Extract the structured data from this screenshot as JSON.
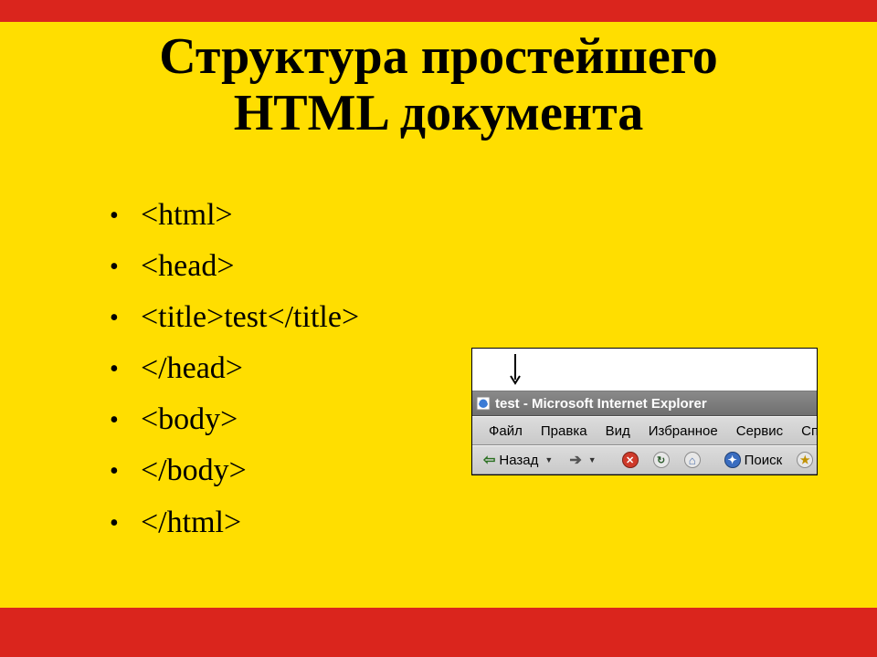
{
  "title_line1": "Структура простейшего",
  "title_line2": "HTML документа",
  "bullets": [
    "<html>",
    "<head>",
    "<title>test</title>",
    "</head>",
    "<body>",
    "</body>",
    "</html>"
  ],
  "browser": {
    "title": "test - Microsoft Internet Explorer",
    "menu": [
      "Файл",
      "Правка",
      "Вид",
      "Избранное",
      "Сервис",
      "Спр"
    ],
    "toolbar": {
      "back": "Назад",
      "search": "Поиск"
    }
  }
}
